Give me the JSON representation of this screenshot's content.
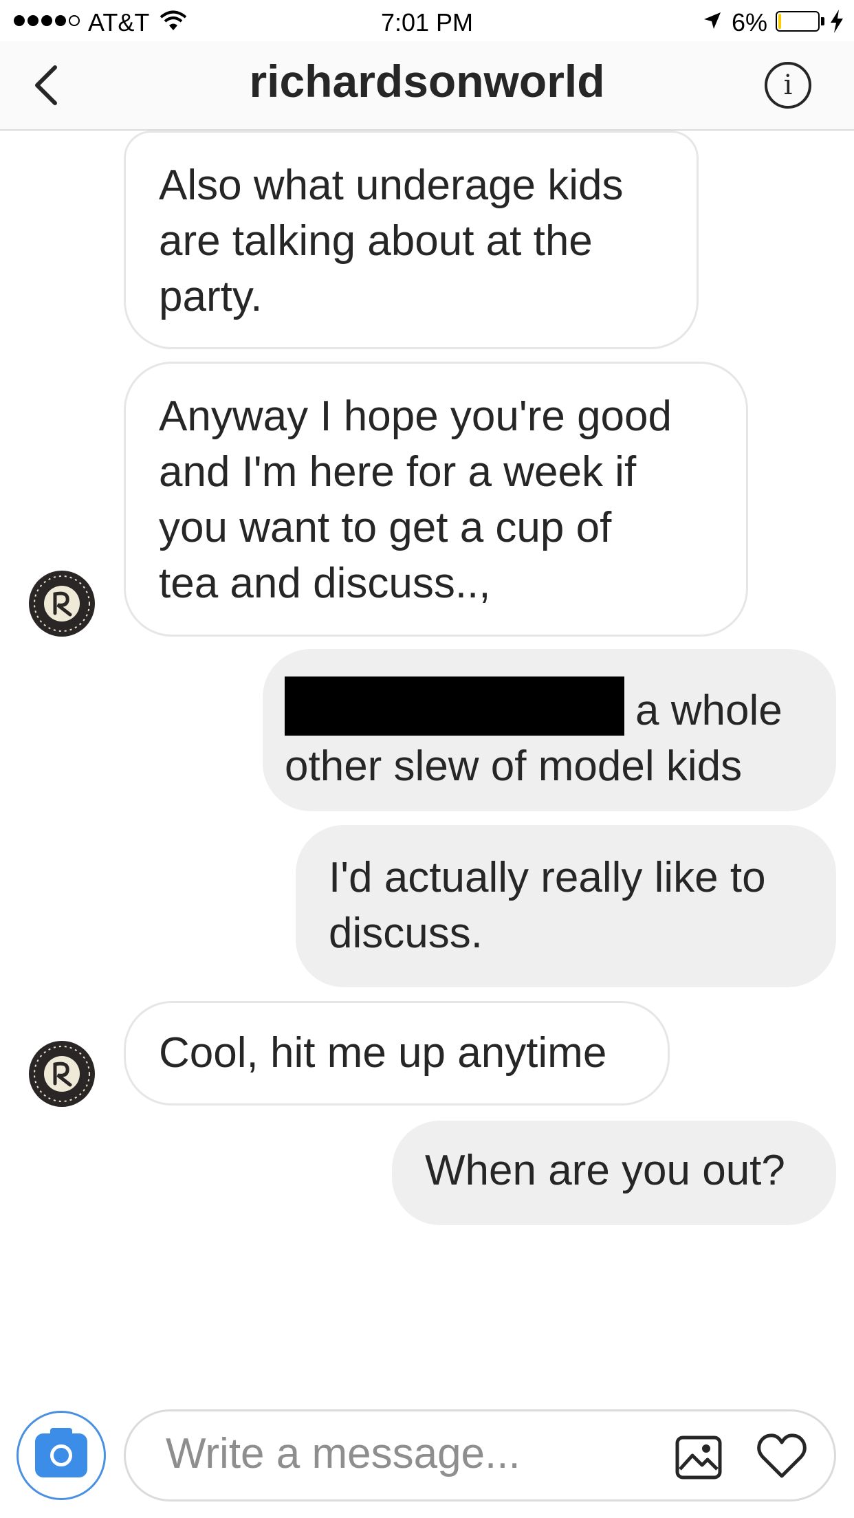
{
  "status_bar": {
    "carrier": "AT&T",
    "time": "7:01 PM",
    "battery_percent": "6%",
    "battery_level": 0.06,
    "signal_bars": 4,
    "icons": [
      "signal-dots-icon",
      "wifi-icon",
      "location-arrow-icon",
      "battery-icon",
      "charging-bolt-icon"
    ]
  },
  "header": {
    "title": "richardsonworld",
    "icons": [
      "back-chevron-icon",
      "info-icon"
    ],
    "info_glyph": "i"
  },
  "messages": [
    {
      "direction": "incoming",
      "lines": [
        "Also what underage kids",
        "are talking about at the",
        "party."
      ]
    },
    {
      "direction": "incoming",
      "lines": [
        "Anyway I hope you're good",
        "and I'm here for a week if",
        "you want to get a cup of",
        "tea and discuss..,"
      ]
    },
    {
      "direction": "outgoing",
      "redacted": true,
      "lines": [
        "a whole",
        "other slew of model kids"
      ]
    },
    {
      "direction": "outgoing",
      "lines": [
        "I'd actually really like to",
        "discuss."
      ]
    },
    {
      "direction": "incoming",
      "lines": [
        "Cool, hit me up anytime"
      ]
    },
    {
      "direction": "outgoing",
      "lines": [
        "When are you out?"
      ]
    }
  ],
  "composer": {
    "placeholder": "Write a message...",
    "icons": [
      "camera-icon",
      "gallery-icon",
      "heart-icon"
    ]
  },
  "colors": {
    "outgoing_bubble": "#efefef",
    "incoming_border": "#e6e6e6",
    "camera_blue": "#3b8de8",
    "battery_low": "#ffcc00"
  }
}
